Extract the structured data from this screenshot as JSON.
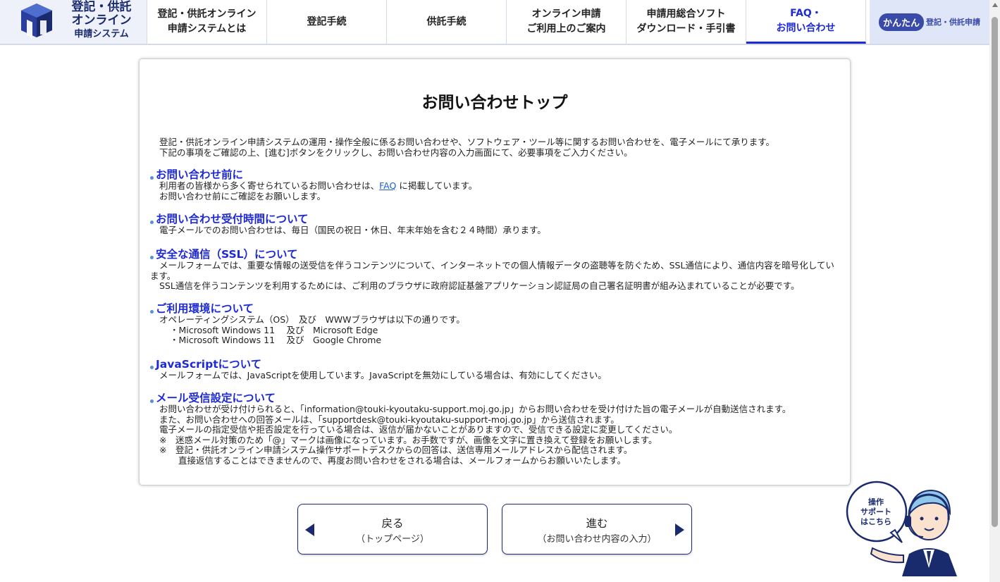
{
  "header": {
    "logo": {
      "line1": "登記・供託",
      "line2": "オンライン",
      "line3": "申請システム"
    },
    "nav": [
      {
        "label": "登記・供託オンライン\n申請システムとは"
      },
      {
        "label": "登記手続"
      },
      {
        "label": "供託手続"
      },
      {
        "label": "オンライン申請\nご利用上のご案内"
      },
      {
        "label": "申請用総合ソフト\nダウンロード・手引書"
      },
      {
        "label": "FAQ・\nお問い合わせ",
        "active": true
      }
    ],
    "kantan": {
      "badge": "かんたん",
      "text": "登記・供託申請"
    }
  },
  "main": {
    "title": "お問い合わせトップ",
    "intro": [
      "登記・供託オンライン申請システムの運用・操作全般に係るお問い合わせや、ソフトウェア・ツール等に関するお問い合わせを、電子メールにて承ります。",
      "下記の事項をご確認の上、[進む]ボタンをクリックし、お問い合わせ内容の入力画面にて、必要事項をご入力ください。"
    ],
    "sections": {
      "before": {
        "title": "お問い合わせ前に",
        "line1_pre": "利用者の皆様から多く寄せられているお問い合わせは、",
        "line1_link": "FAQ",
        "line1_post": " に掲載しています。",
        "line2": "お問い合わせ前にご確認をお願いします。"
      },
      "hours": {
        "title": "お問い合わせ受付時間について",
        "line1": "電子メールでのお問い合わせは、毎日（国民の祝日・休日、年末年始を含む２４時間）承ります。"
      },
      "ssl": {
        "title": "安全な通信（SSL）について",
        "line1": "メールフォームでは、重要な情報の送受信を伴うコンテンツについて、インターネットでの個人情報データの盗聴等を防ぐため、SSL通信により、通信内容を暗号化しています。",
        "line2": "SSL通信を伴うコンテンツを利用するためには、ご利用のブラウザに政府認証基盤アプリケーション認証局の自己署名証明書が組み込まれていることが必要です。"
      },
      "env": {
        "title": "ご利用環境について",
        "line1": "オペレーティングシステム（OS）　及び　WWWブラウザは以下の通りです。",
        "line2": "・Microsoft Windows 11　 及び　Microsoft Edge",
        "line3": "・Microsoft Windows 11　 及び　Google Chrome"
      },
      "js": {
        "title": "JavaScriptについて",
        "line1": "メールフォームでは、JavaScriptを使用しています。JavaScriptを無効にしている場合は、有効にしてください。"
      },
      "mail": {
        "title": "メール受信設定について",
        "line1": "お問い合わせが受け付けられると、「information@touki-kyoutaku-support.moj.go.jp」からお問い合わせを受け付けた旨の電子メールが自動送信されます。",
        "line2": "また、お問い合わせへの回答メールは、「supportdesk@touki-kyoutaku-support-moj.go.jp」から送信されます。",
        "line3": "電子メールの指定受信や拒否設定を行っている場合は、返信が届かないことがありますので、受信できる設定に変更してください。",
        "line4": "※　迷惑メール対策のため「@」マークは画像になっています。お手数ですが、画像を文字に置き換えて登録をお願いします。",
        "line5": "※　登記・供託オンライン申請システム操作サポートデスクからの回答は、送信専用メールアドレスから配信されます。",
        "line6": "直接返信することはできませんので、再度お問い合わせをされる場合は、メールフォームからお願いいたします。"
      }
    }
  },
  "buttons": {
    "back": {
      "label": "戻る",
      "sub": "（トップページ）"
    },
    "next": {
      "label": "進む",
      "sub": "（お問い合わせ内容の入力）"
    }
  },
  "support": {
    "label": "操作\nサポート\nはこちら"
  },
  "colors": {
    "brand": "#1a2b6d",
    "accent_blue": "#1d2ad6",
    "link": "#1d5fd6"
  }
}
